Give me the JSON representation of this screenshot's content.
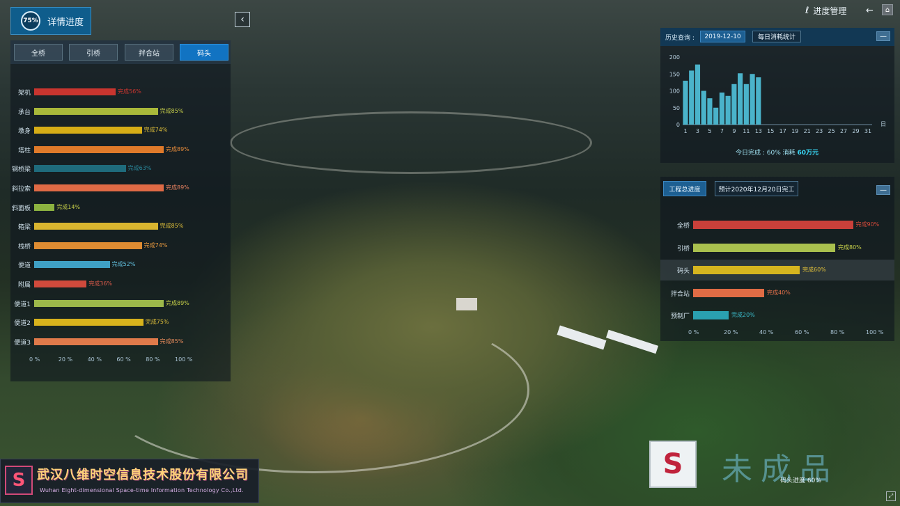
{
  "header": {
    "badge": "75%",
    "title": "详情进度",
    "collapse_icon": "chevron-left-icon",
    "module_title": "进度管理",
    "back_icon": "arrow-left-icon",
    "home_icon": "home-icon",
    "fullscreen_icon": "fullscreen-icon"
  },
  "tabs": [
    {
      "label": "全桥",
      "active": false
    },
    {
      "label": "引桥",
      "active": false
    },
    {
      "label": "拌合站",
      "active": false
    },
    {
      "label": "码头",
      "active": true
    }
  ],
  "detail_progress": {
    "axis_ticks": [
      "0 %",
      "20 %",
      "40 %",
      "60 %",
      "80 %",
      "100 %"
    ],
    "items": [
      {
        "label": "架机",
        "value": 56,
        "text": "完成56%",
        "color": "#c8352f",
        "text_color": "#c8352f"
      },
      {
        "label": "承台",
        "value": 85,
        "text": "完成85%",
        "color": "#a9b93a",
        "text_color": "#c9d24a"
      },
      {
        "label": "墩身",
        "value": 74,
        "text": "完成74%",
        "color": "#d6ad16",
        "text_color": "#e0c03a"
      },
      {
        "label": "塔柱",
        "value": 89,
        "text": "完成89%",
        "color": "#df7a2a",
        "text_color": "#e58a3a"
      },
      {
        "label": "钢桥梁",
        "value": 63,
        "text": "完成63%",
        "color": "#1f6b7c",
        "text_color": "#2a8a9e"
      },
      {
        "label": "斜拉索",
        "value": 89,
        "text": "完成89%",
        "color": "#df6a45",
        "text_color": "#e58060"
      },
      {
        "label": "斜面板",
        "value": 14,
        "text": "完成14%",
        "color": "#8cb240",
        "text_color": "#c9d24a"
      },
      {
        "label": "箱梁",
        "value": 85,
        "text": "完成85%",
        "color": "#d9b52f",
        "text_color": "#e0c03a"
      },
      {
        "label": "栈桥",
        "value": 74,
        "text": "完成74%",
        "color": "#de8c32",
        "text_color": "#e89a40"
      },
      {
        "label": "便道",
        "value": 52,
        "text": "完成52%",
        "color": "#3fa0c4",
        "text_color": "#63c2e0"
      },
      {
        "label": "附属",
        "value": 36,
        "text": "完成36%",
        "color": "#d04a3c",
        "text_color": "#d85a4a"
      },
      {
        "label": "便道1",
        "value": 89,
        "text": "完成89%",
        "color": "#9db84a",
        "text_color": "#c9d24a"
      },
      {
        "label": "便道2",
        "value": 75,
        "text": "完成75%",
        "color": "#d8b31c",
        "text_color": "#e0c03a"
      },
      {
        "label": "便道3",
        "value": 85,
        "text": "完成85%",
        "color": "#e07a4a",
        "text_color": "#e58a5a"
      }
    ]
  },
  "history": {
    "label": "历史查询 :",
    "date": "2019-12-10",
    "daily_button": "每日消耗统计",
    "minimize": "—",
    "today_prefix": "今日完成 : 60% 消耗 ",
    "today_amount": "60万元"
  },
  "chart_data": {
    "type": "bar",
    "x": [
      1,
      2,
      3,
      4,
      5,
      6,
      7,
      8,
      9,
      10,
      11,
      12,
      13
    ],
    "values": [
      130,
      160,
      178,
      100,
      78,
      50,
      95,
      85,
      120,
      152,
      120,
      150,
      140
    ],
    "x_ticks": [
      "1",
      "3",
      "5",
      "7",
      "9",
      "11",
      "13",
      "15",
      "17",
      "19",
      "21",
      "23",
      "25",
      "27",
      "29",
      "31"
    ],
    "x_unit": "日",
    "y_ticks": [
      "0",
      "50",
      "100",
      "150",
      "200"
    ],
    "ylim": [
      0,
      200
    ],
    "xlim": [
      1,
      31
    ],
    "bar_color": "#4fc0d8"
  },
  "overall": {
    "tab": "工程总进度",
    "forecast": "预计2020年12月20日完工",
    "minimize": "—",
    "axis_ticks": [
      "0 %",
      "20 %",
      "40 %",
      "60 %",
      "80 %",
      "100 %"
    ],
    "items": [
      {
        "label": "全桥",
        "value": 90,
        "text": "完成90%",
        "color": "#c9403a",
        "text_color": "#d44a3a"
      },
      {
        "label": "引桥",
        "value": 80,
        "text": "完成80%",
        "color": "#a9c04e",
        "text_color": "#c9d24a"
      },
      {
        "label": "码头",
        "value": 60,
        "text": "完成60%",
        "color": "#d6b51f",
        "text_color": "#e0c03a"
      },
      {
        "label": "拌合站",
        "value": 40,
        "text": "完成40%",
        "color": "#e06c45",
        "text_color": "#e5704a"
      },
      {
        "label": "预制厂",
        "value": 20,
        "text": "完成20%",
        "color": "#2aa0b0",
        "text_color": "#3cc0d0"
      }
    ]
  },
  "watermark": {
    "company_name": "武汉八维时空信息技术股份有限公司",
    "company_name_en": "Wuhan Eight-dimensional Space-time Information Technology Co.,Ltd.",
    "emblem_icon": "company-logo-icon",
    "unfinished": "未成品",
    "pier_progress": "码头进度 60%"
  }
}
